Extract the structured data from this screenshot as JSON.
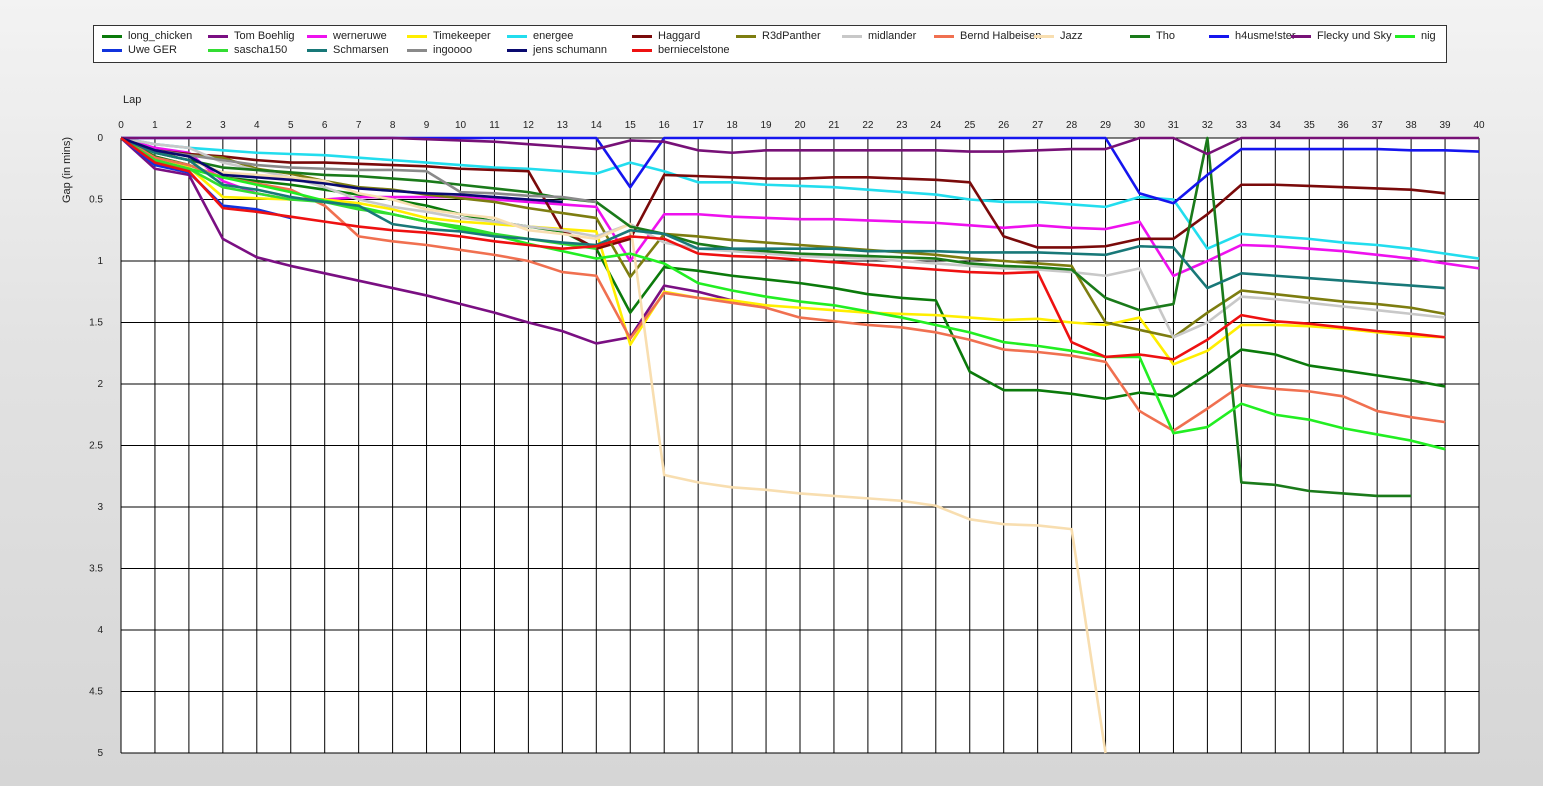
{
  "chart_data": {
    "type": "line",
    "xlabel": "Lap",
    "ylabel": "Gap (in mins)",
    "xlim": [
      0,
      40
    ],
    "ylim": [
      0,
      5
    ],
    "y_inverted": true,
    "grid": true,
    "legend_position": "top",
    "x_ticks": [
      0,
      1,
      2,
      3,
      4,
      5,
      6,
      7,
      8,
      9,
      10,
      11,
      12,
      13,
      14,
      15,
      16,
      17,
      18,
      19,
      20,
      21,
      22,
      23,
      24,
      25,
      26,
      27,
      28,
      29,
      30,
      31,
      32,
      33,
      34,
      35,
      36,
      37,
      38,
      39,
      40
    ],
    "y_ticks": [
      0,
      0.5,
      1,
      1.5,
      2,
      2.5,
      3,
      3.5,
      4,
      4.5,
      5
    ],
    "series": [
      {
        "name": "long_chicken",
        "color": "#0b7a0b",
        "values": [
          0,
          0.15,
          0.22,
          0.32,
          0.35,
          0.38,
          0.42,
          0.46,
          0.5,
          0.55,
          0.62,
          0.68,
          0.72,
          0.76,
          0.9,
          1.42,
          1.05,
          1.08,
          1.12,
          1.15,
          1.18,
          1.22,
          1.27,
          1.3,
          1.32,
          1.9,
          2.05,
          2.05,
          2.08,
          2.12,
          2.07,
          2.1,
          1.92,
          1.72,
          1.76,
          1.85,
          1.89,
          1.93,
          1.97,
          2.02
        ]
      },
      {
        "name": "Tom Boehlig",
        "color": "#7a0f82",
        "values": [
          0,
          0.25,
          0.3,
          0.82,
          0.97,
          1.04,
          1.1,
          1.16,
          1.22,
          1.28,
          1.35,
          1.42,
          1.5,
          1.57,
          1.67,
          1.62,
          1.2,
          1.25,
          1.32,
          1.38
        ]
      },
      {
        "name": "werneruwe",
        "color": "#ee11ee",
        "values": [
          0,
          0.08,
          0.12,
          0.35,
          0.45,
          0.5,
          0.5,
          0.48,
          0.48,
          0.48,
          0.48,
          0.5,
          0.52,
          0.54,
          0.56,
          1.0,
          0.62,
          0.62,
          0.64,
          0.65,
          0.66,
          0.66,
          0.67,
          0.68,
          0.69,
          0.71,
          0.73,
          0.71,
          0.73,
          0.74,
          0.68,
          1.12,
          1.0,
          0.87,
          0.88,
          0.9,
          0.92,
          0.95,
          0.98,
          1.02,
          1.06
        ]
      },
      {
        "name": "Timekeeper",
        "color": "#ffee00",
        "values": [
          0,
          0.18,
          0.24,
          0.48,
          0.49,
          0.5,
          0.5,
          0.53,
          0.58,
          0.65,
          0.68,
          0.7,
          0.72,
          0.74,
          0.76,
          1.68,
          1.25,
          1.3,
          1.32,
          1.36,
          1.38,
          1.4,
          1.42,
          1.43,
          1.44,
          1.46,
          1.48,
          1.47,
          1.5,
          1.52,
          1.46,
          1.84,
          1.73,
          1.52,
          1.52,
          1.53,
          1.55,
          1.58,
          1.61,
          1.62
        ]
      },
      {
        "name": "energee",
        "color": "#22ddee",
        "values": [
          0,
          0.05,
          0.08,
          0.1,
          0.12,
          0.13,
          0.14,
          0.16,
          0.18,
          0.2,
          0.22,
          0.24,
          0.25,
          0.27,
          0.29,
          0.2,
          0.27,
          0.36,
          0.36,
          0.38,
          0.39,
          0.4,
          0.42,
          0.44,
          0.46,
          0.5,
          0.52,
          0.52,
          0.54,
          0.56,
          0.48,
          0.5,
          0.9,
          0.78,
          0.8,
          0.82,
          0.85,
          0.87,
          0.9,
          0.94,
          0.98
        ]
      },
      {
        "name": "Haggard",
        "color": "#7a0a0a",
        "values": [
          0,
          0.1,
          0.13,
          0.15,
          0.18,
          0.2,
          0.2,
          0.21,
          0.22,
          0.23,
          0.25,
          0.26,
          0.27,
          0.75,
          0.9,
          0.82,
          0.3,
          0.31,
          0.32,
          0.33,
          0.33,
          0.32,
          0.32,
          0.33,
          0.34,
          0.36,
          0.8,
          0.89,
          0.89,
          0.88,
          0.82,
          0.82,
          0.62,
          0.38,
          0.38,
          0.39,
          0.4,
          0.41,
          0.42,
          0.45
        ]
      },
      {
        "name": "R3dPanther",
        "color": "#7d7d10",
        "values": [
          0,
          0.12,
          0.14,
          0.16,
          0.25,
          0.29,
          0.35,
          0.4,
          0.42,
          0.46,
          0.49,
          0.52,
          0.57,
          0.61,
          0.65,
          1.13,
          0.78,
          0.8,
          0.83,
          0.85,
          0.87,
          0.89,
          0.91,
          0.93,
          0.95,
          0.98,
          1.0,
          1.02,
          1.04,
          1.5,
          1.56,
          1.62,
          1.42,
          1.24,
          1.27,
          1.3,
          1.33,
          1.35,
          1.38,
          1.43
        ]
      },
      {
        "name": "midlander",
        "color": "#c8c8c8",
        "values": [
          0,
          0.05,
          0.08,
          0.2,
          0.26,
          0.32,
          0.4,
          0.5,
          0.56,
          0.6,
          0.65,
          0.68,
          0.72,
          0.75,
          0.8,
          0.7,
          0.85,
          0.9,
          0.92,
          0.94,
          0.96,
          0.97,
          0.98,
          1.0,
          1.02,
          1.04,
          1.06,
          1.07,
          1.09,
          1.12,
          1.06,
          1.62,
          1.5,
          1.29,
          1.31,
          1.34,
          1.37,
          1.4,
          1.43,
          1.46
        ]
      },
      {
        "name": "Bernd Halbeisen",
        "color": "#f07050",
        "values": [
          0,
          0.16,
          0.22,
          0.32,
          0.37,
          0.42,
          0.55,
          0.8,
          0.84,
          0.87,
          0.91,
          0.95,
          1.0,
          1.09,
          1.12,
          1.63,
          1.26,
          1.3,
          1.34,
          1.38,
          1.46,
          1.49,
          1.52,
          1.54,
          1.58,
          1.64,
          1.72,
          1.74,
          1.77,
          1.82,
          2.22,
          2.38,
          2.2,
          2.01,
          2.04,
          2.06,
          2.1,
          2.22,
          2.27,
          2.31
        ]
      },
      {
        "name": "Jazz",
        "color": "#f8deb0",
        "values": [
          0,
          0.12,
          0.18,
          0.28,
          0.3,
          0.32,
          0.35,
          0.45,
          0.5,
          0.58,
          0.62,
          0.65,
          0.75,
          0.78,
          0.82,
          0.7,
          2.74,
          2.8,
          2.84,
          2.86,
          2.89,
          2.91,
          2.93,
          2.95,
          2.99,
          3.1,
          3.14,
          3.15,
          3.18,
          5.0
        ]
      },
      {
        "name": "Tho",
        "color": "#1a7a1a",
        "values": [
          0,
          0.12,
          0.18,
          0.24,
          0.26,
          0.28,
          0.3,
          0.31,
          0.33,
          0.35,
          0.38,
          0.41,
          0.44,
          0.49,
          0.52,
          0.72,
          0.78,
          0.86,
          0.9,
          0.92,
          0.94,
          0.95,
          0.96,
          0.97,
          0.98,
          1.02,
          1.04,
          1.05,
          1.07,
          1.3,
          1.4,
          1.35,
          0.0,
          2.8,
          2.82,
          2.87,
          2.89,
          2.91,
          2.91
        ]
      },
      {
        "name": "h4usme!ster",
        "color": "#1515ee",
        "values": [
          0,
          0,
          0,
          0,
          0,
          0,
          0,
          0,
          0,
          0,
          0,
          0,
          0,
          0,
          0,
          0.4,
          0,
          0,
          0,
          0,
          0,
          0,
          0,
          0,
          0,
          0,
          0,
          0,
          0,
          0,
          0.45,
          0.53,
          0.3,
          0.09,
          0.09,
          0.09,
          0.09,
          0.09,
          0.1,
          0.1,
          0.11
        ]
      },
      {
        "name": "Flecky und Sky",
        "color": "#771177",
        "values": [
          0,
          0,
          0,
          0,
          0,
          0,
          0,
          0,
          0,
          0.01,
          0.02,
          0.03,
          0.05,
          0.07,
          0.09,
          0.02,
          0.03,
          0.1,
          0.12,
          0.1,
          0.1,
          0.1,
          0.1,
          0.1,
          0.1,
          0.11,
          0.11,
          0.1,
          0.09,
          0.09,
          0.0,
          0.0,
          0.13,
          0.0,
          0.0,
          0.0,
          0.0,
          0.0,
          0.0,
          0.0,
          0.0
        ]
      },
      {
        "name": "nig",
        "color": "#22ee22",
        "values": [
          0,
          0.18,
          0.25,
          0.32,
          0.38,
          0.44,
          0.51,
          0.56,
          0.62,
          0.68,
          0.74,
          0.79,
          0.86,
          0.92,
          0.98,
          0.94,
          1.02,
          1.18,
          1.24,
          1.29,
          1.33,
          1.36,
          1.41,
          1.46,
          1.52,
          1.58,
          1.66,
          1.69,
          1.73,
          1.78,
          1.78,
          2.4,
          2.35,
          2.16,
          2.25,
          2.29,
          2.36,
          2.41,
          2.46,
          2.53
        ]
      },
      {
        "name": "Uwe GER",
        "color": "#1133dd",
        "values": [
          0,
          0.22,
          0.28,
          0.55,
          0.58,
          0.65
        ]
      },
      {
        "name": "sascha150",
        "color": "#33dd33",
        "values": [
          0,
          0.18,
          0.25,
          0.4,
          0.45,
          0.5,
          0.52,
          0.58,
          0.62,
          0.68,
          0.72,
          0.78,
          0.82,
          0.86,
          0.9
        ]
      },
      {
        "name": "Schmarsen",
        "color": "#187878",
        "values": [
          0,
          0.12,
          0.18,
          0.38,
          0.42,
          0.48,
          0.52,
          0.55,
          0.7,
          0.74,
          0.76,
          0.8,
          0.82,
          0.85,
          0.87,
          0.75,
          0.78,
          0.9,
          0.9,
          0.9,
          0.9,
          0.9,
          0.92,
          0.92,
          0.92,
          0.93,
          0.93,
          0.93,
          0.94,
          0.95,
          0.88,
          0.89,
          1.22,
          1.1,
          1.12,
          1.14,
          1.16,
          1.18,
          1.2,
          1.22
        ]
      },
      {
        "name": "ingoooo",
        "color": "#8a8a8a",
        "values": [
          0,
          0.1,
          0.14,
          0.18,
          0.22,
          0.24,
          0.25,
          0.26,
          0.26,
          0.27,
          0.44,
          0.45,
          0.47,
          0.48,
          0.52
        ]
      },
      {
        "name": "jens  schumann",
        "color": "#0a0a70",
        "values": [
          0,
          0.1,
          0.15,
          0.3,
          0.32,
          0.34,
          0.37,
          0.41,
          0.43,
          0.45,
          0.46,
          0.48,
          0.5,
          0.52
        ]
      },
      {
        "name": "berniecelstone",
        "color": "#ee1111",
        "values": [
          0,
          0.2,
          0.27,
          0.57,
          0.6,
          0.64,
          0.68,
          0.72,
          0.75,
          0.77,
          0.8,
          0.84,
          0.87,
          0.9,
          0.88,
          0.8,
          0.82,
          0.94,
          0.96,
          0.97,
          0.99,
          1.01,
          1.03,
          1.05,
          1.07,
          1.09,
          1.1,
          1.09,
          1.66,
          1.78,
          1.76,
          1.8,
          1.64,
          1.44,
          1.49,
          1.51,
          1.54,
          1.57,
          1.59,
          1.62
        ]
      }
    ]
  }
}
